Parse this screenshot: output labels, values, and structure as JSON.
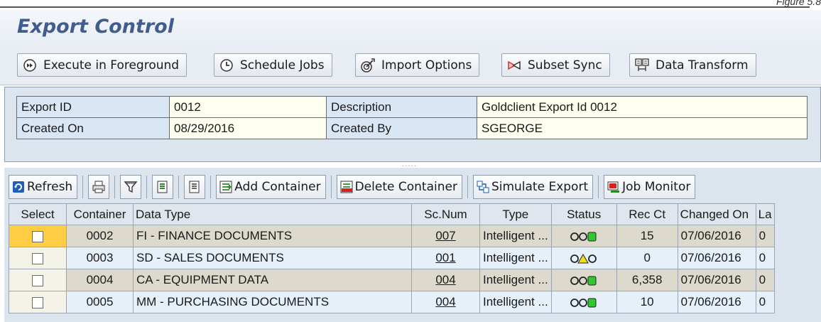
{
  "figure_caption": "Figure 5.8",
  "app_title": "Export Control",
  "toolbar": {
    "buttons": [
      {
        "label": "Execute in Foreground",
        "icon": "execute-icon"
      },
      {
        "label": "Schedule Jobs",
        "icon": "clock-icon"
      },
      {
        "label": "Import Options",
        "icon": "import-options-icon"
      },
      {
        "label": "Subset Sync",
        "icon": "subset-sync-icon"
      },
      {
        "label": "Data Transform",
        "icon": "data-transform-icon"
      }
    ]
  },
  "header": {
    "export_id_label": "Export ID",
    "export_id_value": "0012",
    "description_label": "Description",
    "description_value": "Goldclient Export Id 0012",
    "created_on_label": "Created On",
    "created_on_value": "08/29/2016",
    "created_by_label": "Created By",
    "created_by_value": "SGEORGE"
  },
  "alv_toolbar": {
    "refresh": "Refresh",
    "add_container": "Add Container",
    "delete_container": "Delete Container",
    "simulate_export": "Simulate Export",
    "job_monitor": "Job Monitor"
  },
  "grid": {
    "columns": [
      "Select",
      "Container",
      "Data Type",
      "Sc.Num",
      "Type",
      "Status",
      "Rec Ct",
      "Changed On",
      "La"
    ],
    "rows": [
      {
        "container": "0002",
        "data_type": "FI - FINANCE DOCUMENTS",
        "sc_num": "007",
        "type": "Intelligent ...",
        "status": "green",
        "rec_ct": "15",
        "changed_on": "07/06/2016",
        "last": "0"
      },
      {
        "container": "0003",
        "data_type": "SD - SALES DOCUMENTS",
        "sc_num": "001",
        "type": "Intelligent ...",
        "status": "yellow",
        "rec_ct": "0",
        "changed_on": "07/06/2016",
        "last": "0"
      },
      {
        "container": "0004",
        "data_type": "CA - EQUIPMENT DATA",
        "sc_num": "004",
        "type": "Intelligent ...",
        "status": "green",
        "rec_ct": "6,358",
        "changed_on": "07/06/2016",
        "last": "0"
      },
      {
        "container": "0005",
        "data_type": "MM - PURCHASING DOCUMENTS",
        "sc_num": "004",
        "type": "Intelligent ...",
        "status": "green",
        "rec_ct": "10",
        "changed_on": "07/06/2016",
        "last": "0"
      }
    ]
  },
  "colors": {
    "title": "#3f5e8e",
    "selected_cell": "#ffce45",
    "status_green": "#2fc92f",
    "status_yellow": "#f2dc1c"
  }
}
